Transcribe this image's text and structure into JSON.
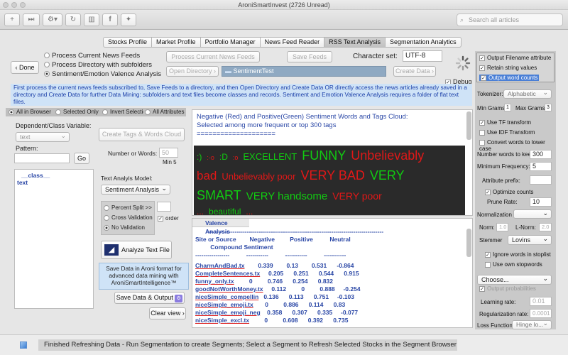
{
  "window": {
    "title": "AroniSmartInvest (2726 Unread)"
  },
  "toolbar": {
    "icons": [
      "add-icon",
      "forward-icon",
      "gear-icon",
      "refresh-icon",
      "columns-icon",
      "facebook-icon",
      "twitter-icon"
    ],
    "search_placeholder": "Search all articles"
  },
  "tabs": [
    "Stocks Profile",
    "Market Profile",
    "Portfolio Manager",
    "News Feed Reader",
    "RSS Text Analysis",
    "Segmentation Analytics"
  ],
  "active_tab": "RSS Text Analysis",
  "process": {
    "done_label": "Done",
    "options": [
      "Process Current News Feeds",
      "Process Directory with subfolders",
      "Sentiment/Emotion Valence Analysis"
    ],
    "selected": 2,
    "process_feeds_btn": "Process Current News Feeds",
    "save_feeds_btn": "Save Feeds",
    "charset_label": "Character set:",
    "charset_value": "UTF-8",
    "open_dir_btn": "Open Directory",
    "dir_value": "SentimentTest",
    "create_data_btn": "Create Data",
    "debug_label": "Debug"
  },
  "info_text": "First process the current news feeds subscribed to, Save Feeds to a directory,  and then Open Directory and Create Data  OR directly access the news articles already saved in a directory and Create Data for further Data Mining: subfolders and text files become classes and records. Sentiment and Emotion Valence  Analysis requires a folder of flat text files.",
  "filter": {
    "options": [
      "All in Browser",
      "Selected Only",
      "Invert Selection",
      "All Attributes"
    ],
    "selected": 0
  },
  "left": {
    "dep_label": "Dependent/Class Variable:",
    "dep_value": "text",
    "pattern_label": "Pattern:",
    "go_label": "Go",
    "list": [
      "__class__",
      "text"
    ]
  },
  "middle": {
    "create_tags_btn": "Create Tags & Words Cloud",
    "words_label": "Number or Words:",
    "words_value": "50",
    "min_label": "Min 5",
    "model_label": "Text Analyis Model:",
    "model_value": "Sentiment Analysis",
    "validation": [
      "Percent Split >>",
      "Cross Validation",
      "No Validation"
    ],
    "validation_selected": 2,
    "order_label": "order",
    "analyze_btn": "Analyze Text File",
    "save_aroni_text": "Save Data in Aroni format for advanced data mining with AroniSmartIntelligence™",
    "save_output_btn": "Save Data & Output",
    "clear_btn": "Clear view"
  },
  "cloud": {
    "header1": "Negative (Red) and Positive(Green) Sentiment Words and Tags Cloud:",
    "header2": "Selected among more frequent or top 300 tags",
    "rule": "====================",
    "lines": [
      [
        [
          ":)",
          "g",
          12
        ],
        [
          ":-o",
          "r",
          9
        ],
        [
          ":D",
          "g",
          12
        ],
        [
          ":o",
          "r",
          9
        ],
        [
          "EXCELLENT",
          "g",
          13
        ],
        [
          "FUNNY",
          "g",
          18
        ],
        [
          "Unbelievably",
          "r",
          18
        ]
      ],
      [
        [
          "bad",
          "r",
          17
        ],
        [
          "Unbelievably poor",
          "r",
          13
        ],
        [
          "VERY BAD",
          "r",
          18
        ],
        [
          "VERY",
          "g",
          18
        ]
      ],
      [
        [
          "SMART",
          "g",
          18
        ],
        [
          "VERY handsome",
          "g",
          15
        ],
        [
          "VERY poor",
          "r",
          14
        ]
      ],
      [
        [
          "...",
          "r",
          12
        ],
        [
          "beautiful",
          "g",
          12
        ],
        [
          "...",
          "r",
          12
        ]
      ]
    ]
  },
  "valence": {
    "tab_label": "Valence Analysis",
    "dashes": "----------------------------------------------------------------------------------------",
    "col_header1": "Site or Source        Negative         Positive          Neutral",
    "col_header2": "         Compound Sentiment",
    "underline": "-----------------          -----------          -----------          -----------",
    "rows": [
      {
        "name": "CharmAndBad.tx",
        "vals": "        0.339        0.13        0.531      -0.864"
      },
      {
        "name": "CompleteSentences.tx",
        "vals": "     0.205      0.251      0.544      0.915"
      },
      {
        "name": "funny_only.tx",
        "vals": "         0         0.746      0.254      0.832"
      },
      {
        "name": "goodNotWorthMoney.tx",
        "vals": "     0.112         0         0.888     -0.254"
      },
      {
        "name": "niceSimple_compellin",
        "vals": "   0.136      0.113      0.751     -0.103"
      },
      {
        "name": "niceSimple_emoji.tx",
        "vals": "       0         0.886      0.114      0.83"
      },
      {
        "name": "niceSimple_emoji_neg",
        "vals": "    0.358      0.307      0.335     -0.077"
      },
      {
        "name": "niceSimple_excl.tx",
        "vals": "         0         0.608      0.392      0.735"
      }
    ]
  },
  "right": {
    "output_filename": "Output Filename attribute",
    "retain": "Retain string values",
    "word_counts": "Output word counts",
    "tokenizer_label": "Tokenizer:",
    "tokenizer_value": "Alphabetic",
    "min_grams_label": "Min Grams:",
    "min_grams_value": "1",
    "max_grams_label": "Max Grams",
    "max_grams_value": "3",
    "use_tf": "Use TF transform",
    "use_idf": "Use IDF Transform",
    "lower_case": "Convert words to lower case",
    "keep_label": "Number words to keep",
    "keep_value": "300",
    "min_freq_label": "Minimum Frequency:",
    "min_freq_value": "5",
    "prefix_label": "Attribute prefix:",
    "prefix_value": "",
    "optimize": "Optimize counts",
    "prune_label": "Prune Rate:",
    "prune_value": "10",
    "normalization_label": "Normalization",
    "norm_label": "Norm:",
    "norm_value": "1.0",
    "lnorm_label": "L-Norm:",
    "lnorm_value": "2.0",
    "stemmer_label": "Stemmer",
    "stemmer_value": "Lovins",
    "ignore_stoplist": "Ignore words in stoplist",
    "own_stopwords": "Use own stopwords",
    "choose_value": "Choose...",
    "output_prob": "Output probabilities",
    "learning_label": "Learning rate:",
    "learning_value": "0.01",
    "reg_label": "Regularization rate:",
    "reg_value": "0.0001",
    "loss_label": "Loss Function:",
    "loss_value": "Hinge lo..."
  },
  "status": {
    "text": "Finished Refreshing Data - Run Segmentation to create Segments; Select a Segment to Refresh Selected Stocks in the Segment Browser"
  },
  "colors": {
    "positive": "#11cc11",
    "negative": "#e01818",
    "cloud_bg": "#2a2a2a",
    "info_bg": "#cfe3f7",
    "info_text": "#1a3ea8"
  }
}
